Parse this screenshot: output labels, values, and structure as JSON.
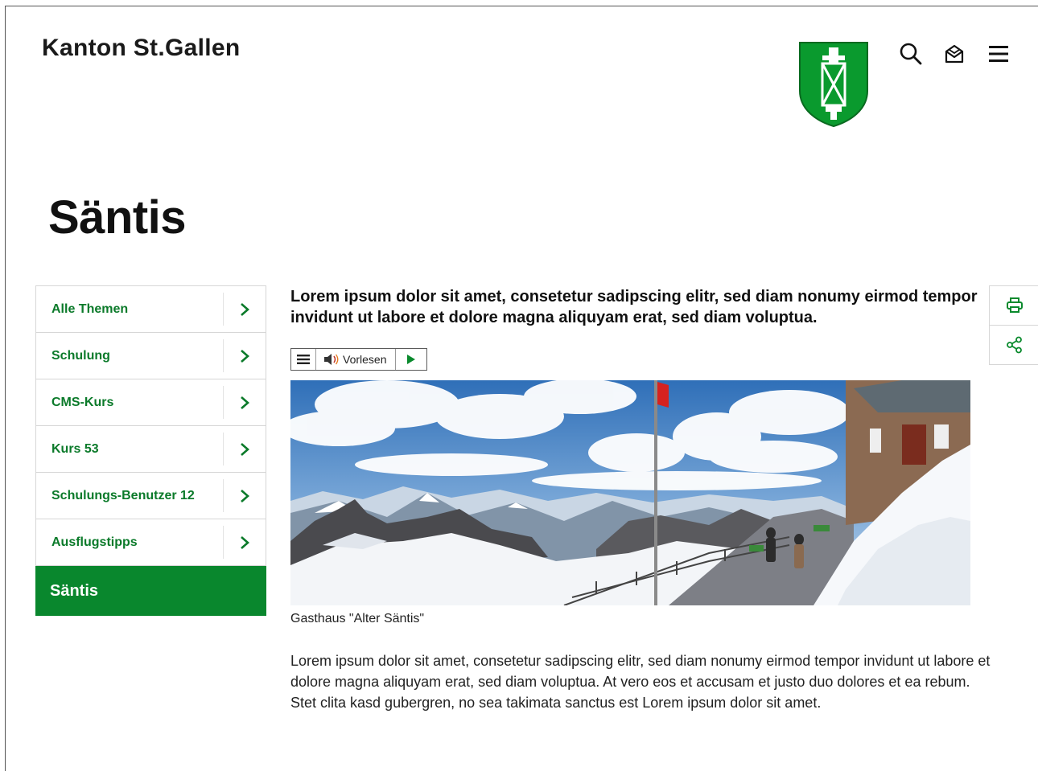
{
  "header": {
    "brand": "Kanton St.Gallen",
    "coat_of_arms_icon": "st-gallen-coat-of-arms",
    "search_icon": "search-icon",
    "mail_icon": "newsletter-icon",
    "menu_icon": "hamburger-menu-icon"
  },
  "page": {
    "title": "Säntis"
  },
  "sidenav": {
    "items": [
      {
        "label": "Alle Themen"
      },
      {
        "label": "Schulung"
      },
      {
        "label": "CMS-Kurs"
      },
      {
        "label": "Kurs 53"
      },
      {
        "label": "Schulungs-Benutzer 12"
      },
      {
        "label": "Ausflugstipps"
      }
    ],
    "active": "Säntis"
  },
  "content": {
    "lead": "Lorem ipsum dolor sit amet, consetetur sadipscing elitr, sed diam nonumy eirmod tempor invidunt ut labore et dolore magna aliquyam erat, sed diam voluptua.",
    "readspeaker": {
      "label": "Vorlesen"
    },
    "image_caption": "Gasthaus \"Alter Säntis\"",
    "body": "Lorem ipsum dolor sit amet, consetetur sadipscing elitr, sed diam nonumy eirmod tempor invidunt ut labore et dolore magna aliquyam erat, sed diam voluptua. At vero eos et accusam et justo duo dolores et ea rebum. Stet clita kasd gubergren, no sea takimata sanctus est Lorem ipsum dolor sit amet."
  },
  "tools": {
    "print_icon": "print-icon",
    "share_icon": "share-icon"
  },
  "colors": {
    "accent_green": "#09872d",
    "link_green": "#0b7a2a"
  }
}
